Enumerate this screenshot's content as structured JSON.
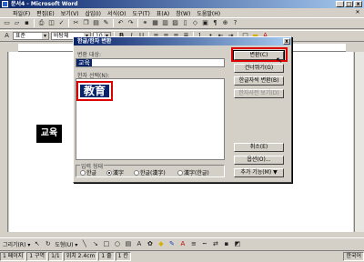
{
  "window": {
    "title": "문서4 - Microsoft Word",
    "min": "_",
    "max": "□",
    "close": "x"
  },
  "menu": [
    "파일(F)",
    "편집(E)",
    "보기(V)",
    "삽입(I)",
    "서식(O)",
    "도구(T)",
    "표(A)",
    "창(W)",
    "도움말(H)"
  ],
  "toolbar": {
    "style": "표준",
    "font": "바탕체",
    "size": "10"
  },
  "document": {
    "text": "교육"
  },
  "dialog": {
    "title": "한글/한자 변환",
    "close": "x",
    "source_label": "변환 대상:",
    "source_value": "교육",
    "candidates_label": "한자 선택(N):",
    "candidates": [
      "教育"
    ],
    "buttons": [
      {
        "label": "변환(C)",
        "enabled": true,
        "default": true
      },
      {
        "label": "건너뛰기(G)",
        "enabled": true
      },
      {
        "label": "한글자씩 변환(B)",
        "enabled": true
      },
      {
        "label": "한자사전 보기(D)",
        "enabled": false
      },
      {
        "label": "취소(E)",
        "enabled": true
      },
      {
        "label": "옵션(O)...",
        "enabled": true
      },
      {
        "label": "추가 기능(M) ▼",
        "enabled": true
      }
    ],
    "form_label": "입력 형태",
    "form_options": [
      {
        "label": "한글",
        "selected": false
      },
      {
        "label": "漢字",
        "selected": true
      },
      {
        "label": "한글(漢字)",
        "selected": false
      },
      {
        "label": "漢字(한글)",
        "selected": false
      }
    ]
  },
  "drawing": {
    "draw_label": "그리기(R) ▾",
    "autoshape_label": "도형(U) ▾"
  },
  "status": {
    "page": "1 페이지",
    "section": "1 구역",
    "pages": "1/1",
    "position": "위치 2.4cm",
    "line": "1 줄",
    "col": "1 칸",
    "lang": "한국어"
  }
}
